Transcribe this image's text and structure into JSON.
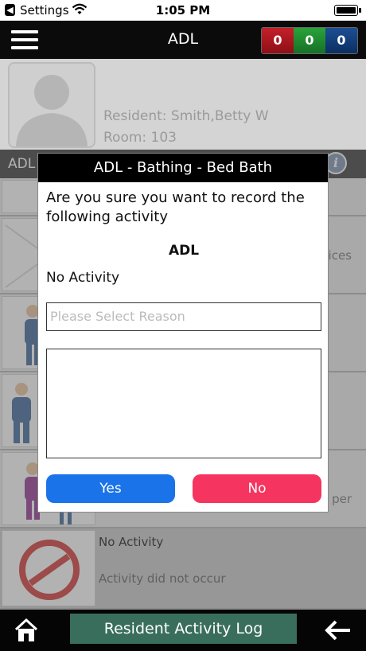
{
  "status_bar": {
    "carrier": "Settings",
    "time": "1:05 PM",
    "icons": [
      "back-chevron-icon",
      "wifi-icon",
      "battery-icon"
    ]
  },
  "header": {
    "title": "ADL",
    "counters": [
      {
        "value": "0",
        "color": "#b3141c"
      },
      {
        "value": "0",
        "color": "#1f8a2e"
      },
      {
        "value": "0",
        "color": "#173f7a"
      }
    ]
  },
  "resident": {
    "name": "Resident: Smith,Betty W",
    "room": "Room: 103"
  },
  "section": {
    "label": "ADL"
  },
  "background_rows": [
    {
      "text": ""
    },
    {
      "text": "ices"
    },
    {
      "text": ""
    },
    {
      "text": ""
    },
    {
      "text": "per"
    }
  ],
  "no_activity_row": {
    "title": "No Activity",
    "subtitle": "Activity did not occur"
  },
  "dialog": {
    "title": "ADL - Bathing - Bed Bath",
    "message": "Are you sure you want to record the following activity",
    "category": "ADL",
    "activity": "No Activity",
    "reason_placeholder": "Please Select Reason",
    "notes_value": "",
    "yes_label": "Yes",
    "no_label": "No",
    "colors": {
      "yes": "#1a73e8",
      "no": "#f5355f"
    }
  },
  "footer": {
    "log_label": "Resident Activity Log",
    "log_color": "#3a6e5c"
  }
}
